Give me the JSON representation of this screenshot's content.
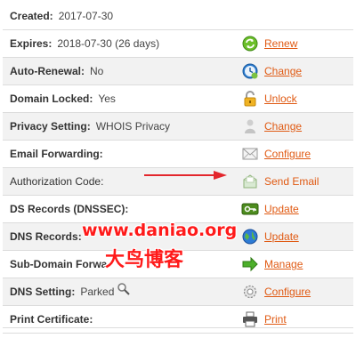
{
  "rows": [
    {
      "label": "Created:",
      "value": "2017-07-30",
      "action": "",
      "icon": ""
    },
    {
      "label": "Expires:",
      "value": "2018-07-30 (26 days)",
      "action": "Renew",
      "icon": "renew-icon"
    },
    {
      "label": "Auto-Renewal:",
      "value": "No",
      "action": "Change",
      "icon": "clock-icon"
    },
    {
      "label": "Domain Locked:",
      "value": "Yes",
      "action": "Unlock",
      "icon": "padlock-icon"
    },
    {
      "label": "Privacy Setting:",
      "value": "WHOIS Privacy",
      "action": "Change",
      "icon": "privacy-icon"
    },
    {
      "label": "Email Forwarding:",
      "value": "",
      "action": "Configure",
      "icon": "envelope-icon"
    },
    {
      "label": "Authorization Code:",
      "value": "",
      "action": "Send Email",
      "icon": "open-envelope-icon"
    },
    {
      "label": "DS Records (DNSSEC):",
      "value": "",
      "action": "Update",
      "icon": "key-icon"
    },
    {
      "label": "DNS Records:",
      "value": "",
      "action": "Update",
      "icon": "globe-icon"
    },
    {
      "label": "Sub-Domain Forwa",
      "value": "",
      "action": "Manage",
      "icon": "green-arrow-icon"
    },
    {
      "label": "DNS Setting:",
      "value": "Parked",
      "action": "Configure",
      "icon": "gear-icon"
    },
    {
      "label": "Print Certificate:",
      "value": "",
      "action": "Print",
      "icon": "printer-icon"
    }
  ],
  "watermark": {
    "url": "www.daniao.org",
    "name": "大鸟博客"
  },
  "colors": {
    "link": "#e05a13",
    "alt_row": "#f2f2f2",
    "annotation": "#e3262c"
  }
}
